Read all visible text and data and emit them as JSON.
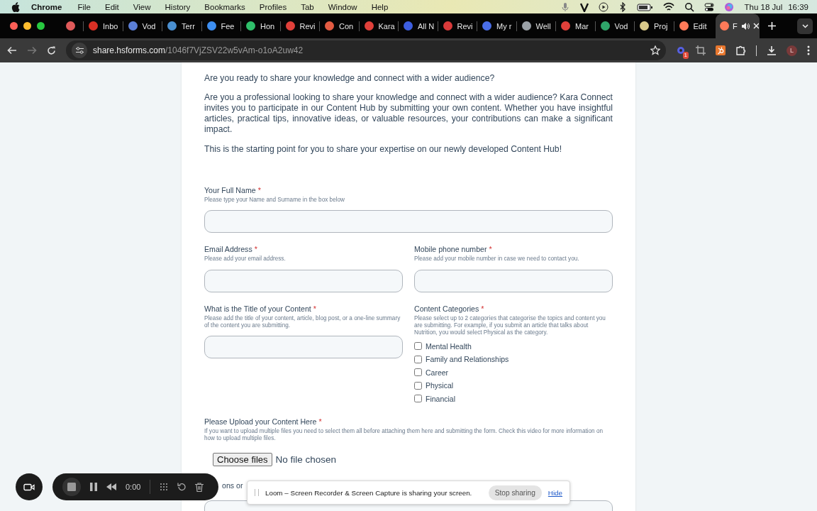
{
  "menubar": {
    "app": "Chrome",
    "menus": [
      "File",
      "Edit",
      "View",
      "History",
      "Bookmarks",
      "Profiles",
      "Tab",
      "Window",
      "Help"
    ],
    "date": "Thu 18 Jul",
    "time": "16:39"
  },
  "tabs": [
    {
      "kind": "pinned",
      "color": "#e05a5a",
      "selected": false,
      "audible": false
    },
    {
      "kind": "page",
      "title": "Inbo",
      "color": "#d93025",
      "selected": false,
      "audible": false
    },
    {
      "kind": "page",
      "title": "Vod",
      "color": "#5b7fd6",
      "selected": false,
      "audible": false
    },
    {
      "kind": "page",
      "title": "Terr",
      "color": "#4a8fd0",
      "selected": false,
      "audible": false
    },
    {
      "kind": "page",
      "title": "Fee",
      "color": "#3d8ef0",
      "selected": false,
      "audible": false
    },
    {
      "kind": "page",
      "title": "Hon",
      "color": "#2fbf6a",
      "selected": false,
      "audible": false
    },
    {
      "kind": "page",
      "title": "Revi",
      "color": "#e0403a",
      "selected": false,
      "audible": false
    },
    {
      "kind": "page",
      "title": "Con",
      "color": "#e35b42",
      "selected": false,
      "audible": false
    },
    {
      "kind": "page",
      "title": "Kara",
      "color": "#e0403a",
      "selected": false,
      "audible": false
    },
    {
      "kind": "page",
      "title": "All N",
      "color": "#3d5ee0",
      "selected": false,
      "audible": false
    },
    {
      "kind": "page",
      "title": "Revi",
      "color": "#d93a3a",
      "selected": false,
      "audible": false
    },
    {
      "kind": "page",
      "title": "My r",
      "color": "#4a6ee8",
      "selected": false,
      "audible": false
    },
    {
      "kind": "page",
      "title": "Well",
      "color": "#9aa0a6",
      "selected": false,
      "audible": false
    },
    {
      "kind": "page",
      "title": "Mar",
      "color": "#e0403a",
      "selected": false,
      "audible": false
    },
    {
      "kind": "page",
      "title": "Vod",
      "color": "#2fa56a",
      "selected": false,
      "audible": false
    },
    {
      "kind": "page",
      "title": "Proj",
      "color": "#d8c88a",
      "selected": false,
      "audible": false
    },
    {
      "kind": "page",
      "title": "Edit",
      "color": "#ff7a59",
      "selected": false,
      "audible": false
    },
    {
      "kind": "page",
      "title": "F",
      "color": "#ff7a59",
      "selected": true,
      "audible": true
    }
  ],
  "address_bar": {
    "host": "share.hsforms.com",
    "path": "/1046f7VjZSV22w5vAm-o1oA2uw42",
    "extension_badge": "1",
    "profile_initial": "L"
  },
  "form": {
    "question": "Are you ready to share your knowledge and connect with a wider audience?",
    "intro": "Are you a professional looking to share your knowledge and connect with a wider audience? Kara Connect invites you to participate in our Content Hub by submitting your own content. Whether you have insightful articles, practical tips, innovative ideas, or valuable resources, your contributions can make a significant impact.",
    "closing": "This is the starting point for you to share your expertise on our newly developed Content Hub!",
    "rows": [
      [
        {
          "kind": "text",
          "label": "Your Full Name",
          "required_mark": "*",
          "hint": "Please type your Name and Surname in the box below"
        }
      ],
      [
        {
          "kind": "text",
          "label": "Email Address",
          "required_mark": "*",
          "hint": "Please add your email address."
        },
        {
          "kind": "text",
          "label": "Mobile phone number",
          "required_mark": "*",
          "hint": "Please add your mobile number in case we need to contact you."
        }
      ],
      [
        {
          "kind": "text",
          "label": "What is the Title of your Content",
          "required_mark": "*",
          "hint": "Please add the title of your content, article, blog post, or a one-line summary of the content you are submitting."
        },
        {
          "kind": "checkboxes",
          "label": "Content Categories",
          "required_mark": "*",
          "hint": "Please select up to 2 categories that categorise the topics and content you are submitting. For example, if you submit an article that talks about Nutrition, you would select Physical as the category.",
          "options": [
            {
              "label": "Mental Health",
              "checked": false
            },
            {
              "label": "Family and Relationships",
              "checked": false
            },
            {
              "label": "Career",
              "checked": false
            },
            {
              "label": "Physical",
              "checked": false
            },
            {
              "label": "Financial",
              "checked": false
            }
          ]
        }
      ],
      [
        {
          "kind": "file",
          "label": "Please Upload your Content Here",
          "required_mark": "*",
          "hint": "If you want to upload multiple files you need to select them all before attaching them here and submitting the form. Check this video for more information on how to upload multiple files.",
          "button": "Choose files",
          "status": "No file chosen"
        }
      ],
      [
        {
          "kind": "text",
          "label": "ons or"
        }
      ]
    ]
  },
  "recorder": {
    "time": "0:00"
  },
  "share_notice": {
    "text": "Loom – Screen Recorder & Screen Capture is sharing your screen.",
    "stop": "Stop sharing",
    "hide": "Hide"
  }
}
